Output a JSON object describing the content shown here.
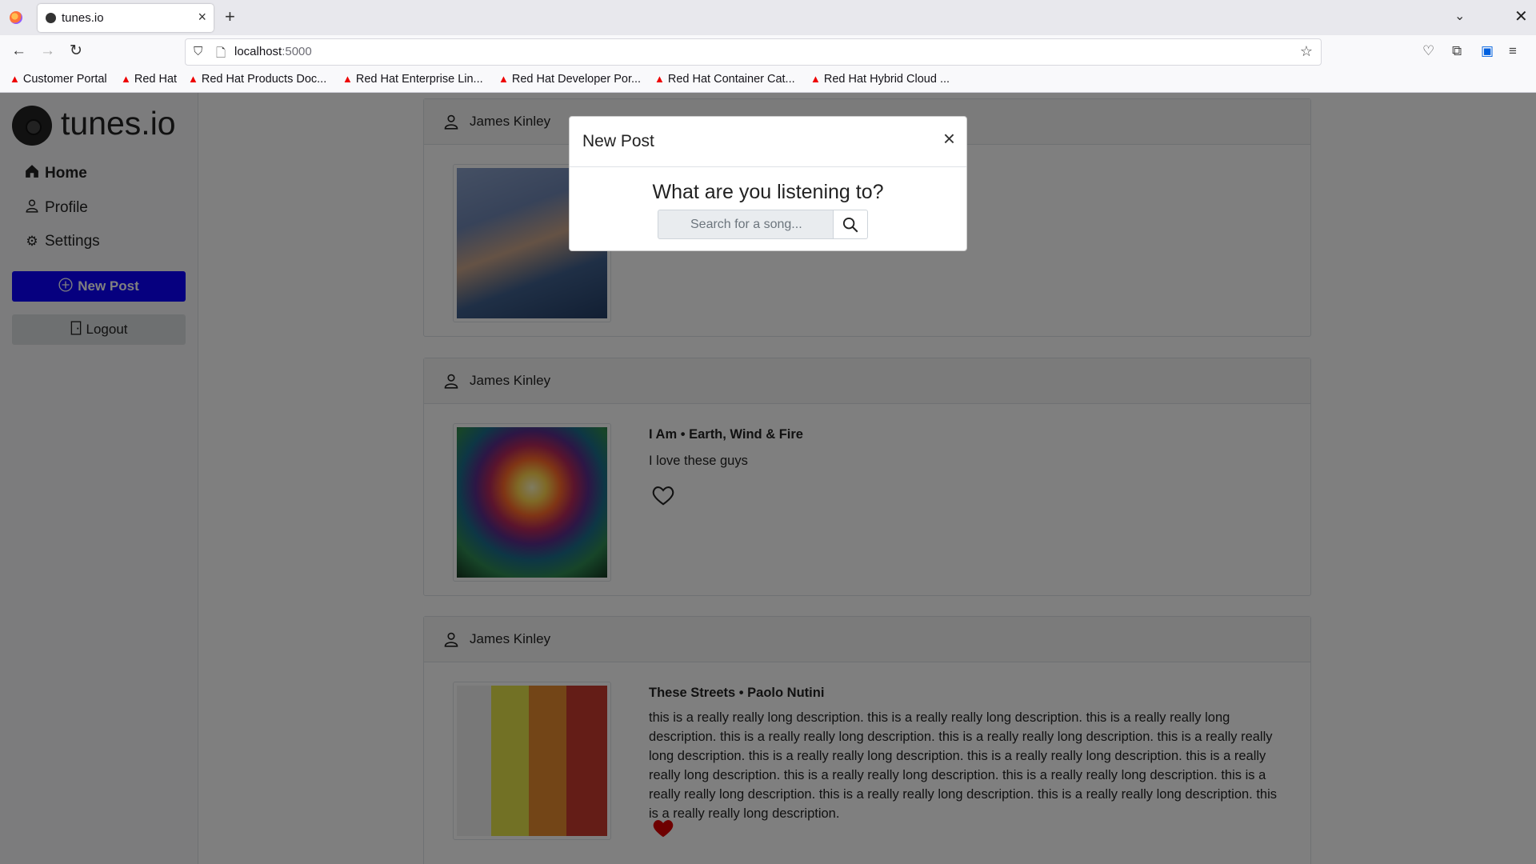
{
  "browser": {
    "tab_title": "tunes.io",
    "tab_close": "×",
    "new_tab": "+",
    "url_host": "localhost",
    "url_port": ":5000",
    "bookmarks": [
      "Customer Portal",
      "Red Hat",
      "Red Hat Products Doc...",
      "Red Hat Enterprise Lin...",
      "Red Hat Developer Por...",
      "Red Hat Container Cat...",
      "Red Hat Hybrid Cloud ..."
    ]
  },
  "app": {
    "name": "tunes.io",
    "nav": {
      "home": "Home",
      "profile": "Profile",
      "settings": "Settings"
    },
    "new_post_label": "New Post",
    "logout_label": "Logout"
  },
  "posts": [
    {
      "user": "James Kinley",
      "title": "",
      "description": "",
      "liked": false
    },
    {
      "user": "James Kinley",
      "title": "I Am • Earth, Wind & Fire",
      "description": "I love these guys",
      "liked": false
    },
    {
      "user": "James Kinley",
      "title": "These Streets • Paolo Nutini",
      "description": "this is a really really long description. this is a really really long description. this is a really really long description. this is a really really long description. this is a really really long description. this is a really really long description. this is a really really long description. this is a really really long description. this is a really really long description. this is a really really long description. this is a really really long description. this is a really really long description. this is a really really long description. this is a really really long description. this is a really really long description.",
      "liked": true
    }
  ],
  "modal": {
    "title": "New Post",
    "close": "×",
    "question": "What are you listening to?",
    "search_placeholder": "Search for a song..."
  },
  "colors": {
    "primary": "#0d00ff",
    "heart_liked": "#dc0000"
  }
}
